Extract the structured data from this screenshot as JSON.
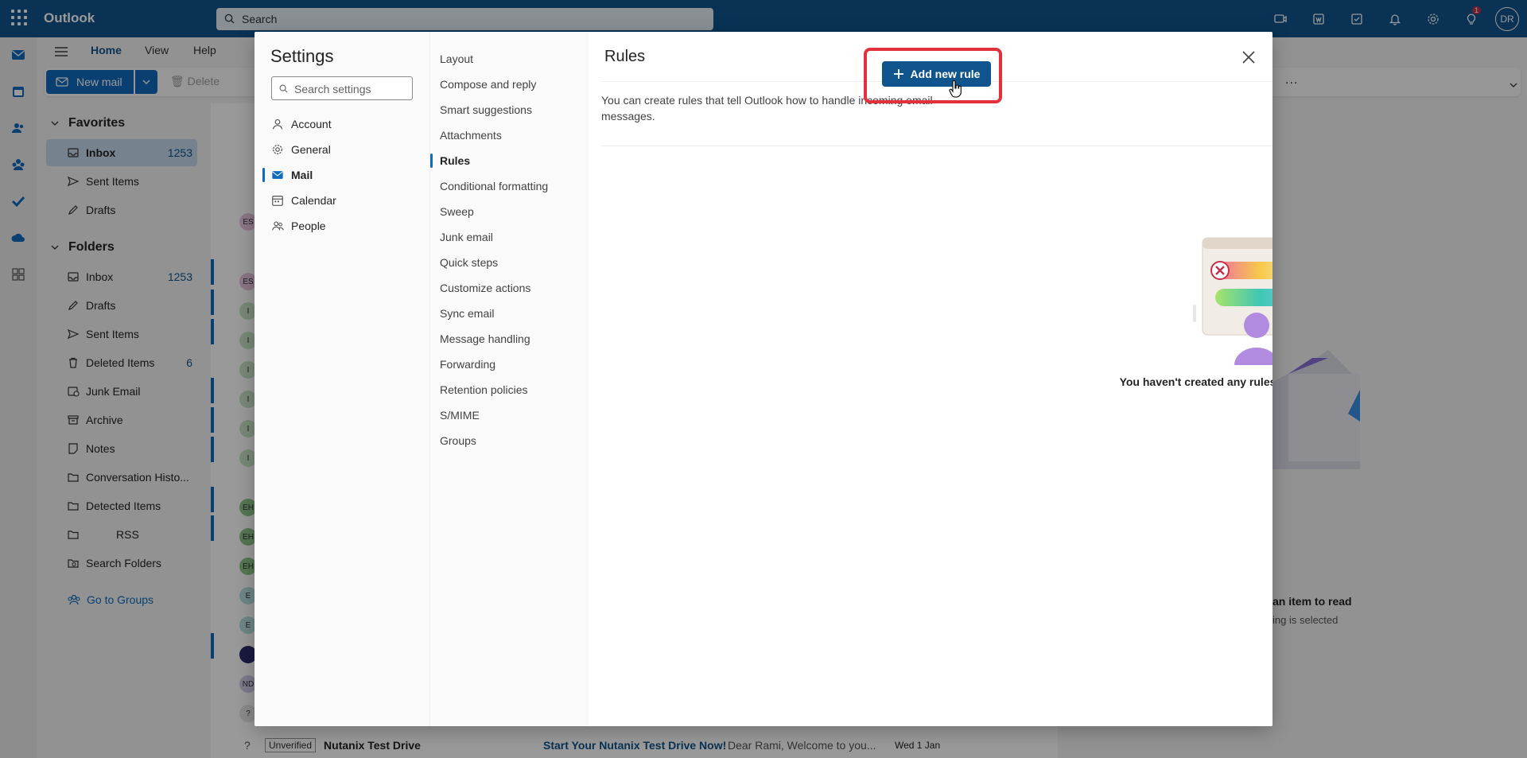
{
  "app": {
    "title": "Outlook",
    "search_placeholder": "Search",
    "avatar_initials": "DR",
    "tips_badge": "1"
  },
  "ribbon": {
    "tabs": [
      "Home",
      "View",
      "Help"
    ],
    "new_mail": "New mail",
    "delete": "Delete",
    "more": "..."
  },
  "folders": {
    "favorites_header": "Favorites",
    "favorites": [
      {
        "label": "Inbox",
        "count": "1253"
      },
      {
        "label": "Sent Items",
        "count": ""
      },
      {
        "label": "Drafts",
        "count": ""
      }
    ],
    "folders_header": "Folders",
    "items": [
      {
        "label": "Inbox",
        "count": "1253"
      },
      {
        "label": "Drafts",
        "count": ""
      },
      {
        "label": "Sent Items",
        "count": ""
      },
      {
        "label": "Deleted Items",
        "count": "6"
      },
      {
        "label": "Junk Email",
        "count": ""
      },
      {
        "label": "Archive",
        "count": ""
      },
      {
        "label": "Notes",
        "count": ""
      },
      {
        "label": "Conversation Histo...",
        "count": ""
      },
      {
        "label": "Detected Items",
        "count": ""
      },
      {
        "label": "RSS",
        "count": ""
      },
      {
        "label": "Search Folders",
        "count": ""
      }
    ],
    "go_to_groups": "Go to Groups"
  },
  "message_list": {
    "avatars": [
      "ES",
      "ES",
      "I",
      "I",
      "I",
      "I",
      "I",
      "I",
      "EH",
      "EH",
      "EH",
      "E",
      "E",
      "",
      "ND",
      "?"
    ],
    "bottom_row": {
      "tag": "Unverified",
      "sender": "Nutanix Test Drive",
      "subject": "Start Your Nutanix Test Drive Now!",
      "preview": "Dear Rami, Welcome to you...",
      "date": "Wed 1 Jan"
    }
  },
  "reading_pane": {
    "line1": "an item to read",
    "line2": "ing is selected"
  },
  "settings": {
    "title": "Settings",
    "search_placeholder": "Search settings",
    "categories": [
      {
        "label": "Account",
        "icon": "person-icon"
      },
      {
        "label": "General",
        "icon": "gear-icon"
      },
      {
        "label": "Mail",
        "icon": "mail-icon"
      },
      {
        "label": "Calendar",
        "icon": "calendar-icon"
      },
      {
        "label": "People",
        "icon": "people-icon"
      }
    ],
    "active_category": "Mail",
    "subcategories": [
      "Layout",
      "Compose and reply",
      "Smart suggestions",
      "Attachments",
      "Rules",
      "Conditional formatting",
      "Sweep",
      "Junk email",
      "Quick steps",
      "Customize actions",
      "Sync email",
      "Message handling",
      "Forwarding",
      "Retention policies",
      "S/MIME",
      "Groups"
    ],
    "active_subcategory": "Rules"
  },
  "rules": {
    "title": "Rules",
    "description": "You can create rules that tell Outlook how to handle incoming email messages.",
    "add_button": "Add new rule",
    "empty_message": "You haven't created any rules yet."
  },
  "colors": {
    "brand": "#0f548c",
    "accent": "#0f6cbd",
    "highlight": "#e2303d"
  }
}
